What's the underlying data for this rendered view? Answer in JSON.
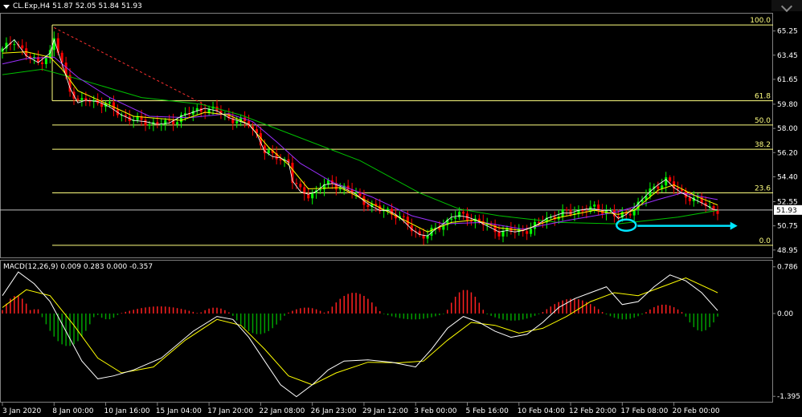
{
  "header": {
    "symbol": "CL.Exp,H4",
    "ohlc": "51.87 52.05 51.84 51.93"
  },
  "macd_label": "MACD(12,26,9) 0.009 0.283 0.000 -0.357",
  "colors": {
    "background": "#000000",
    "bull_candle": "#00ff00",
    "bear_candle": "#ff0000",
    "ma_fast": "#ffff00",
    "ma_mid": "#9b30ff",
    "ma_slow": "#00c000",
    "fib_line": "#ffff80",
    "trend_line": "#ff3030",
    "annotation": "#00e5ff",
    "macd_pos": "#ff2020",
    "macd_neg": "#00a000",
    "macd_main": "#ffffff",
    "macd_signal": "#ffff00"
  },
  "chart_data": [
    {
      "type": "candlestick",
      "ylim": [
        48.4,
        66.6
      ],
      "y_ticks": [
        "65.25",
        "63.45",
        "61.65",
        "59.80",
        "58.00",
        "56.20",
        "54.40",
        "52.55",
        "50.75",
        "48.95"
      ],
      "y_tick_values": [
        65.25,
        63.45,
        61.65,
        59.8,
        58.0,
        56.2,
        54.4,
        52.55,
        50.75,
        48.95
      ],
      "x_ticks": [
        "3 Jan 2020",
        "8 Jan 00:00",
        "10 Jan 16:00",
        "15 Jan 04:00",
        "17 Jan 20:00",
        "22 Jan 08:00",
        "26 Jan 23:00",
        "29 Jan 12:00",
        "3 Feb 00:00",
        "5 Feb 16:00",
        "10 Feb 04:00",
        "12 Feb 20:00",
        "17 Feb 08:00",
        "20 Feb 00:00"
      ],
      "x_tick_index": [
        0,
        13,
        26,
        39,
        52,
        65,
        78,
        91,
        104,
        117,
        130,
        143,
        156,
        169
      ],
      "bar_count": 181,
      "current_price": "51.93",
      "current_value": 51.93,
      "fibonacci": [
        {
          "level": "100.0",
          "price": 65.7
        },
        {
          "level": "61.8",
          "price": 60.06
        },
        {
          "level": "50.0",
          "price": 58.25
        },
        {
          "level": "38.2",
          "price": 56.45
        },
        {
          "level": "23.6",
          "price": 53.2
        },
        {
          "level": "0.0",
          "price": 49.3
        }
      ],
      "trend_line": {
        "from": [
          13,
          65.5
        ],
        "to": [
          52,
          59.6
        ]
      },
      "close_path": [
        [
          0,
          63.8
        ],
        [
          3,
          64.6
        ],
        [
          6,
          63.4
        ],
        [
          9,
          62.9
        ],
        [
          12,
          63.6
        ],
        [
          13,
          64.6
        ],
        [
          15,
          62.8
        ],
        [
          17,
          61.0
        ],
        [
          19,
          59.9
        ],
        [
          21,
          60.1
        ],
        [
          24,
          60.0
        ],
        [
          27,
          59.6
        ],
        [
          30,
          59.0
        ],
        [
          33,
          58.6
        ],
        [
          36,
          58.5
        ],
        [
          39,
          58.3
        ],
        [
          42,
          58.4
        ],
        [
          45,
          58.9
        ],
        [
          48,
          59.2
        ],
        [
          51,
          59.5
        ],
        [
          54,
          59.3
        ],
        [
          57,
          58.8
        ],
        [
          60,
          58.5
        ],
        [
          62,
          58.3
        ],
        [
          64,
          57.6
        ],
        [
          66,
          56.3
        ],
        [
          68,
          55.9
        ],
        [
          70,
          55.8
        ],
        [
          72,
          55.5
        ],
        [
          73,
          54.1
        ],
        [
          75,
          53.3
        ],
        [
          77,
          53.1
        ],
        [
          79,
          53.3
        ],
        [
          81,
          53.8
        ],
        [
          83,
          53.9
        ],
        [
          85,
          53.7
        ],
        [
          87,
          53.4
        ],
        [
          89,
          53.1
        ],
        [
          91,
          52.6
        ],
        [
          93,
          52.2
        ],
        [
          95,
          51.9
        ],
        [
          97,
          51.9
        ],
        [
          99,
          51.6
        ],
        [
          101,
          51.1
        ],
        [
          103,
          50.5
        ],
        [
          105,
          50.1
        ],
        [
          107,
          50.0
        ],
        [
          109,
          50.5
        ],
        [
          111,
          50.9
        ],
        [
          113,
          51.4
        ],
        [
          115,
          51.5
        ],
        [
          117,
          51.4
        ],
        [
          119,
          51.2
        ],
        [
          121,
          50.9
        ],
        [
          123,
          50.6
        ],
        [
          125,
          50.3
        ],
        [
          127,
          50.4
        ],
        [
          129,
          50.3
        ],
        [
          131,
          50.4
        ],
        [
          133,
          50.6
        ],
        [
          135,
          50.9
        ],
        [
          137,
          51.3
        ],
        [
          139,
          51.5
        ],
        [
          141,
          51.7
        ],
        [
          143,
          51.7
        ],
        [
          145,
          51.9
        ],
        [
          147,
          52.0
        ],
        [
          149,
          52.0
        ],
        [
          151,
          51.9
        ],
        [
          153,
          51.9
        ],
        [
          155,
          51.3
        ],
        [
          157,
          51.6
        ],
        [
          159,
          52.1
        ],
        [
          161,
          52.7
        ],
        [
          163,
          53.3
        ],
        [
          165,
          53.8
        ],
        [
          167,
          54.2
        ],
        [
          169,
          53.6
        ],
        [
          171,
          53.2
        ],
        [
          173,
          52.9
        ],
        [
          175,
          52.6
        ],
        [
          177,
          52.3
        ],
        [
          179,
          51.95
        ],
        [
          180,
          51.93
        ]
      ],
      "ma_fast_path": [
        [
          0,
          63.6
        ],
        [
          6,
          63.7
        ],
        [
          12,
          63.3
        ],
        [
          15,
          62.4
        ],
        [
          19,
          60.8
        ],
        [
          25,
          60.0
        ],
        [
          33,
          58.9
        ],
        [
          45,
          58.6
        ],
        [
          51,
          59.2
        ],
        [
          57,
          59.0
        ],
        [
          62,
          58.3
        ],
        [
          67,
          56.6
        ],
        [
          72,
          55.3
        ],
        [
          77,
          53.5
        ],
        [
          85,
          53.6
        ],
        [
          93,
          52.4
        ],
        [
          101,
          51.2
        ],
        [
          107,
          50.3
        ],
        [
          113,
          51.0
        ],
        [
          119,
          51.2
        ],
        [
          125,
          50.6
        ],
        [
          131,
          50.4
        ],
        [
          139,
          51.3
        ],
        [
          149,
          51.9
        ],
        [
          155,
          51.6
        ],
        [
          159,
          51.9
        ],
        [
          165,
          53.4
        ],
        [
          169,
          53.8
        ],
        [
          175,
          52.9
        ],
        [
          180,
          52.3
        ]
      ],
      "ma_mid_path": [
        [
          0,
          62.8
        ],
        [
          6,
          63.2
        ],
        [
          13,
          63.3
        ],
        [
          19,
          61.8
        ],
        [
          27,
          60.3
        ],
        [
          37,
          58.9
        ],
        [
          47,
          58.8
        ],
        [
          57,
          59.1
        ],
        [
          63,
          58.5
        ],
        [
          69,
          57.0
        ],
        [
          75,
          55.4
        ],
        [
          83,
          54.0
        ],
        [
          93,
          52.9
        ],
        [
          103,
          51.5
        ],
        [
          111,
          50.9
        ],
        [
          121,
          51.0
        ],
        [
          131,
          50.5
        ],
        [
          143,
          51.2
        ],
        [
          155,
          51.8
        ],
        [
          165,
          52.7
        ],
        [
          171,
          53.2
        ],
        [
          180,
          52.7
        ]
      ],
      "ma_slow_path": [
        [
          0,
          62.0
        ],
        [
          10,
          62.4
        ],
        [
          20,
          61.6
        ],
        [
          35,
          60.3
        ],
        [
          50,
          59.8
        ],
        [
          60,
          59.0
        ],
        [
          75,
          57.3
        ],
        [
          90,
          55.6
        ],
        [
          105,
          53.2
        ],
        [
          115,
          52.0
        ],
        [
          125,
          51.5
        ],
        [
          140,
          51.0
        ],
        [
          155,
          50.9
        ],
        [
          170,
          51.4
        ],
        [
          180,
          51.9
        ]
      ],
      "annotation": {
        "ellipse_index": 157,
        "ellipse_price": 50.8,
        "arrow_to_index": 185,
        "arrow_price": 50.75
      }
    },
    {
      "type": "macd",
      "ylim": [
        -1.5,
        0.85
      ],
      "y_ticks": [
        "0.786",
        "0.00",
        "-1.395"
      ],
      "y_tick_values": [
        0.786,
        0.0,
        -1.395
      ],
      "params": "12,26,9",
      "main_path": [
        [
          0,
          0.3
        ],
        [
          4,
          0.7
        ],
        [
          8,
          0.5
        ],
        [
          12,
          0.2
        ],
        [
          16,
          -0.3
        ],
        [
          20,
          -0.8
        ],
        [
          24,
          -1.1
        ],
        [
          28,
          -1.05
        ],
        [
          33,
          -0.95
        ],
        [
          40,
          -0.75
        ],
        [
          48,
          -0.3
        ],
        [
          54,
          -0.05
        ],
        [
          58,
          -0.1
        ],
        [
          62,
          -0.4
        ],
        [
          66,
          -0.8
        ],
        [
          70,
          -1.2
        ],
        [
          74,
          -1.4
        ],
        [
          78,
          -1.2
        ],
        [
          82,
          -0.95
        ],
        [
          86,
          -0.8
        ],
        [
          92,
          -0.78
        ],
        [
          98,
          -0.82
        ],
        [
          104,
          -0.9
        ],
        [
          108,
          -0.6
        ],
        [
          112,
          -0.25
        ],
        [
          116,
          -0.05
        ],
        [
          120,
          -0.15
        ],
        [
          124,
          -0.3
        ],
        [
          128,
          -0.4
        ],
        [
          132,
          -0.35
        ],
        [
          136,
          -0.15
        ],
        [
          140,
          0.1
        ],
        [
          144,
          0.25
        ],
        [
          148,
          0.35
        ],
        [
          152,
          0.45
        ],
        [
          156,
          0.15
        ],
        [
          160,
          0.2
        ],
        [
          164,
          0.45
        ],
        [
          168,
          0.65
        ],
        [
          172,
          0.55
        ],
        [
          176,
          0.35
        ],
        [
          180,
          0.05
        ]
      ],
      "signal_path": [
        [
          0,
          0.1
        ],
        [
          6,
          0.4
        ],
        [
          12,
          0.3
        ],
        [
          18,
          -0.2
        ],
        [
          24,
          -0.75
        ],
        [
          30,
          -1.0
        ],
        [
          38,
          -0.9
        ],
        [
          46,
          -0.45
        ],
        [
          54,
          -0.1
        ],
        [
          60,
          -0.2
        ],
        [
          66,
          -0.6
        ],
        [
          72,
          -1.05
        ],
        [
          78,
          -1.2
        ],
        [
          84,
          -1.0
        ],
        [
          92,
          -0.82
        ],
        [
          100,
          -0.83
        ],
        [
          106,
          -0.8
        ],
        [
          112,
          -0.45
        ],
        [
          118,
          -0.15
        ],
        [
          124,
          -0.2
        ],
        [
          130,
          -0.33
        ],
        [
          136,
          -0.25
        ],
        [
          142,
          -0.05
        ],
        [
          148,
          0.2
        ],
        [
          154,
          0.35
        ],
        [
          160,
          0.3
        ],
        [
          166,
          0.45
        ],
        [
          172,
          0.6
        ],
        [
          180,
          0.35
        ]
      ],
      "hist_segments": [
        [
          0,
          8,
          0.3,
          "rise"
        ],
        [
          8,
          10,
          0.1,
          "fall"
        ],
        [
          10,
          24,
          -0.55,
          "neg"
        ],
        [
          24,
          30,
          -0.1,
          "neg"
        ],
        [
          30,
          50,
          0.12,
          "pos"
        ],
        [
          50,
          58,
          0.1,
          "pos"
        ],
        [
          58,
          72,
          -0.35,
          "neg"
        ],
        [
          72,
          82,
          0.1,
          "pos"
        ],
        [
          82,
          96,
          0.35,
          "pos"
        ],
        [
          96,
          112,
          -0.1,
          "neg"
        ],
        [
          112,
          122,
          0.4,
          "pos"
        ],
        [
          122,
          136,
          -0.12,
          "neg"
        ],
        [
          136,
          152,
          0.25,
          "pos"
        ],
        [
          152,
          162,
          -0.1,
          "neg"
        ],
        [
          162,
          172,
          0.15,
          "pos"
        ],
        [
          172,
          181,
          -0.3,
          "neg"
        ]
      ]
    }
  ]
}
